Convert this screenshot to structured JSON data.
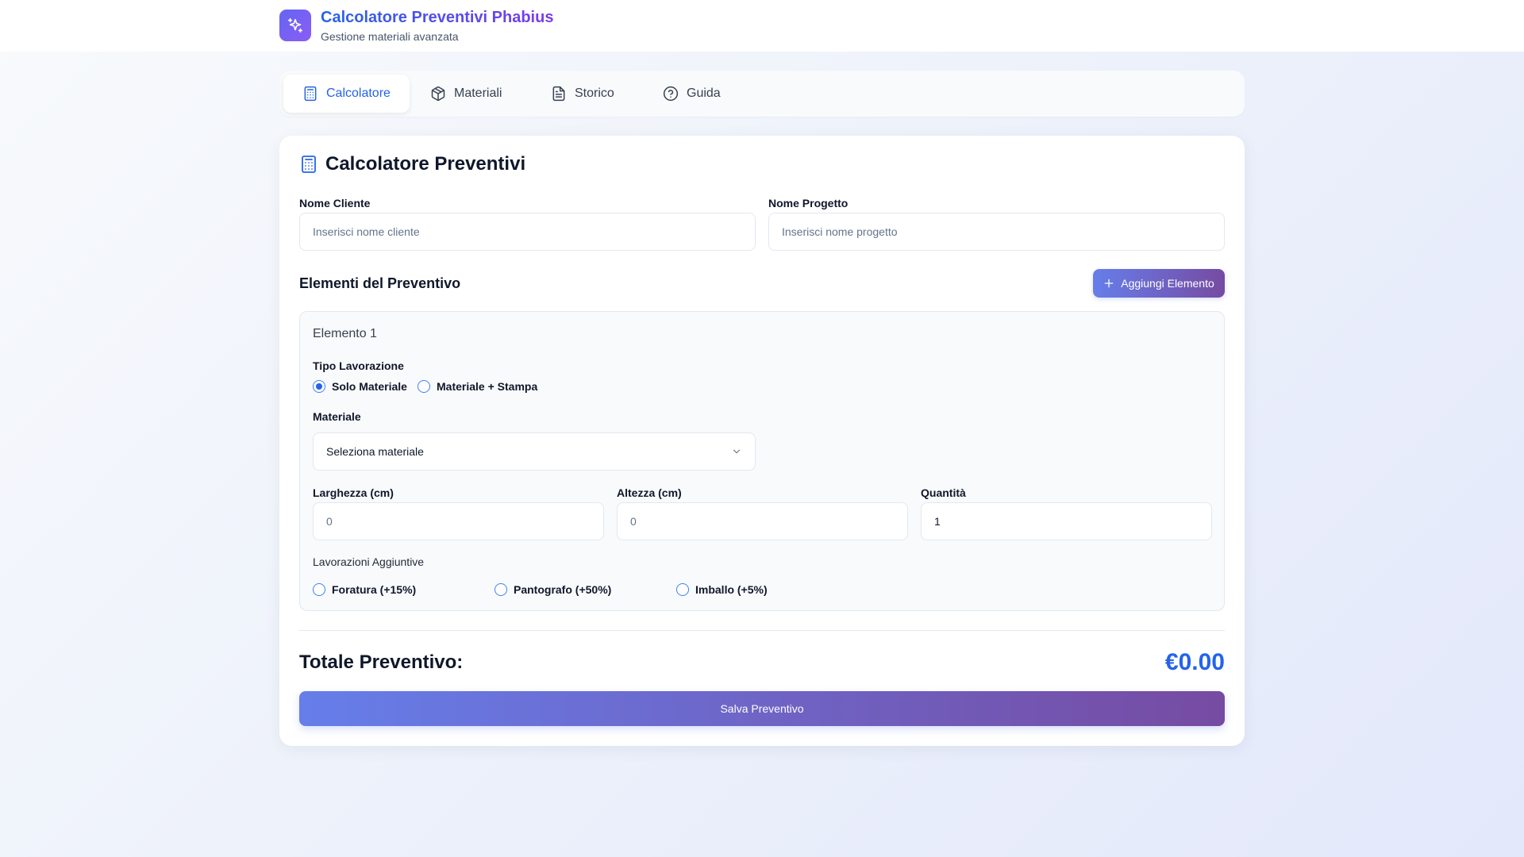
{
  "header": {
    "title": "Calcolatore Preventivi Phabius",
    "subtitle": "Gestione materiali avanzata",
    "logo_icon": "sparkles-icon"
  },
  "tabs": [
    {
      "label": "Calcolatore",
      "icon": "calculator-icon",
      "active": true
    },
    {
      "label": "Materiali",
      "icon": "package-icon",
      "active": false
    },
    {
      "label": "Storico",
      "icon": "file-text-icon",
      "active": false
    },
    {
      "label": "Guida",
      "icon": "help-circle-icon",
      "active": false
    }
  ],
  "calculator": {
    "title": "Calcolatore Preventivi",
    "client_label": "Nome Cliente",
    "client_placeholder": "Inserisci nome cliente",
    "project_label": "Nome Progetto",
    "project_placeholder": "Inserisci nome progetto",
    "items_title": "Elementi del Preventivo",
    "add_button": "Aggiungi Elemento"
  },
  "element": {
    "title": "Elemento 1",
    "work_type_label": "Tipo Lavorazione",
    "work_type_options": [
      "Solo Materiale",
      "Materiale + Stampa"
    ],
    "work_type_selected": "Solo Materiale",
    "material_label": "Materiale",
    "material_value": "Seleziona materiale",
    "width_label": "Larghezza (cm)",
    "width_placeholder": "0",
    "height_label": "Altezza (cm)",
    "height_placeholder": "0",
    "quantity_label": "Quantità",
    "quantity_value": "1",
    "extras_label": "Lavorazioni Aggiuntive",
    "extras": [
      "Foratura (+15%)",
      "Pantografo (+50%)",
      "Imballo (+5%)"
    ]
  },
  "totals": {
    "label": "Totale Preventivo:",
    "value": "€0.00",
    "save_button": "Salva Preventivo"
  },
  "colors": {
    "accent": "#2563eb",
    "gradient_start": "#667eea",
    "gradient_end": "#764ba2"
  }
}
